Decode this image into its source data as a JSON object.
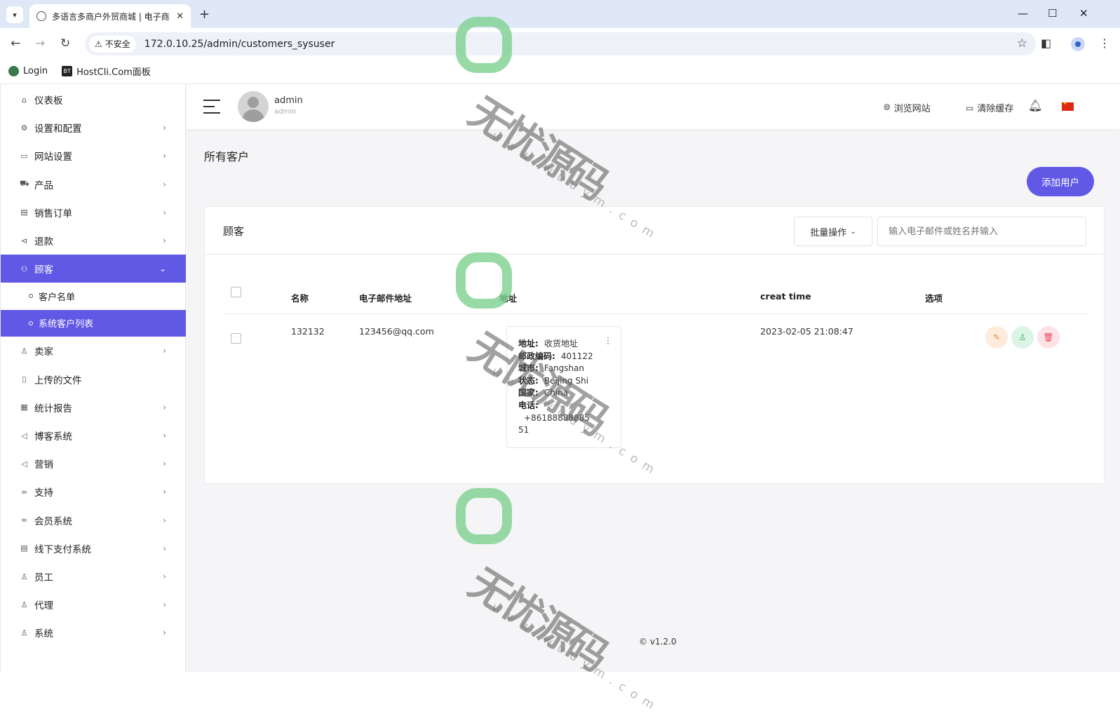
{
  "browser": {
    "tab_title": "多语言多商户外贸商城 | 电子商",
    "not_secure": "不安全",
    "url": "172.0.10.25/admin/customers_sysuser",
    "bookmarks": [
      "Login",
      "HostCli.Com面板"
    ]
  },
  "sidebar": {
    "items": [
      {
        "label": "仪表板",
        "icon": "home-icon",
        "glyph": "⌂"
      },
      {
        "label": "设置和配置",
        "icon": "settings-icon",
        "glyph": "⚙"
      },
      {
        "label": "网站设置",
        "icon": "monitor-icon",
        "glyph": "▭"
      },
      {
        "label": "产品",
        "icon": "cart-icon",
        "glyph": "⛟"
      },
      {
        "label": "销售订单",
        "icon": "money-icon",
        "glyph": "▤"
      },
      {
        "label": "退款",
        "icon": "refund-icon",
        "glyph": "⊲"
      },
      {
        "label": "顾客",
        "icon": "users-icon",
        "glyph": "⚇"
      },
      {
        "label": "卖家",
        "icon": "user-icon",
        "glyph": "♙"
      },
      {
        "label": "上传的文件",
        "icon": "file-icon",
        "glyph": "▯"
      },
      {
        "label": "统计报告",
        "icon": "report-icon",
        "glyph": "▦"
      },
      {
        "label": "博客系统",
        "icon": "megaphone-icon",
        "glyph": "◁"
      },
      {
        "label": "营销",
        "icon": "megaphone-icon",
        "glyph": "◁"
      },
      {
        "label": "支持",
        "icon": "link-icon",
        "glyph": "∞"
      },
      {
        "label": "会员系统",
        "icon": "link-icon",
        "glyph": "∞"
      },
      {
        "label": "线下支付系统",
        "icon": "money-icon",
        "glyph": "▤"
      },
      {
        "label": "员工",
        "icon": "user-icon",
        "glyph": "♙"
      },
      {
        "label": "代理",
        "icon": "user-icon",
        "glyph": "♙"
      },
      {
        "label": "系统",
        "icon": "user-icon",
        "glyph": "♙"
      }
    ],
    "sub_items": [
      "客户名单",
      "系统客户列表"
    ]
  },
  "topbar": {
    "user_name": "admin",
    "user_role": "admin",
    "browse_site": "浏览网站",
    "clear_cache": "清除缓存"
  },
  "page": {
    "title": "所有客户",
    "add_button": "添加用户",
    "card_title": "顾客",
    "bulk_action": "批量操作",
    "search_placeholder": "输入电子邮件或姓名并输入"
  },
  "table": {
    "headers": [
      "名称",
      "电子邮件地址",
      "地址",
      "creat time",
      "选项"
    ],
    "row": {
      "name": "132132",
      "email": "123456@qq.com",
      "address": {
        "label_address": "地址:",
        "value_address": "收货地址",
        "label_postal": "邮政编码:",
        "value_postal": "401122",
        "label_city": "城市:",
        "value_city": "Fangshan",
        "label_state": "状态:",
        "value_state": "Beijing Shi",
        "label_country": "国家:",
        "value_country": "China",
        "label_phone": "电话:",
        "value_phone_1": "+86188888885",
        "value_phone_2": "51"
      },
      "created": "2023-02-05 21:08:47"
    }
  },
  "footer": {
    "version": "v1.2.0"
  },
  "watermark": {
    "text": "无忧源码",
    "site": "www.wuuym.com"
  },
  "colors": {
    "accent": "#6158e6",
    "edit_bg": "#fdebdc",
    "view_bg": "#dcf4e6",
    "delete_bg": "#fde2e6"
  }
}
